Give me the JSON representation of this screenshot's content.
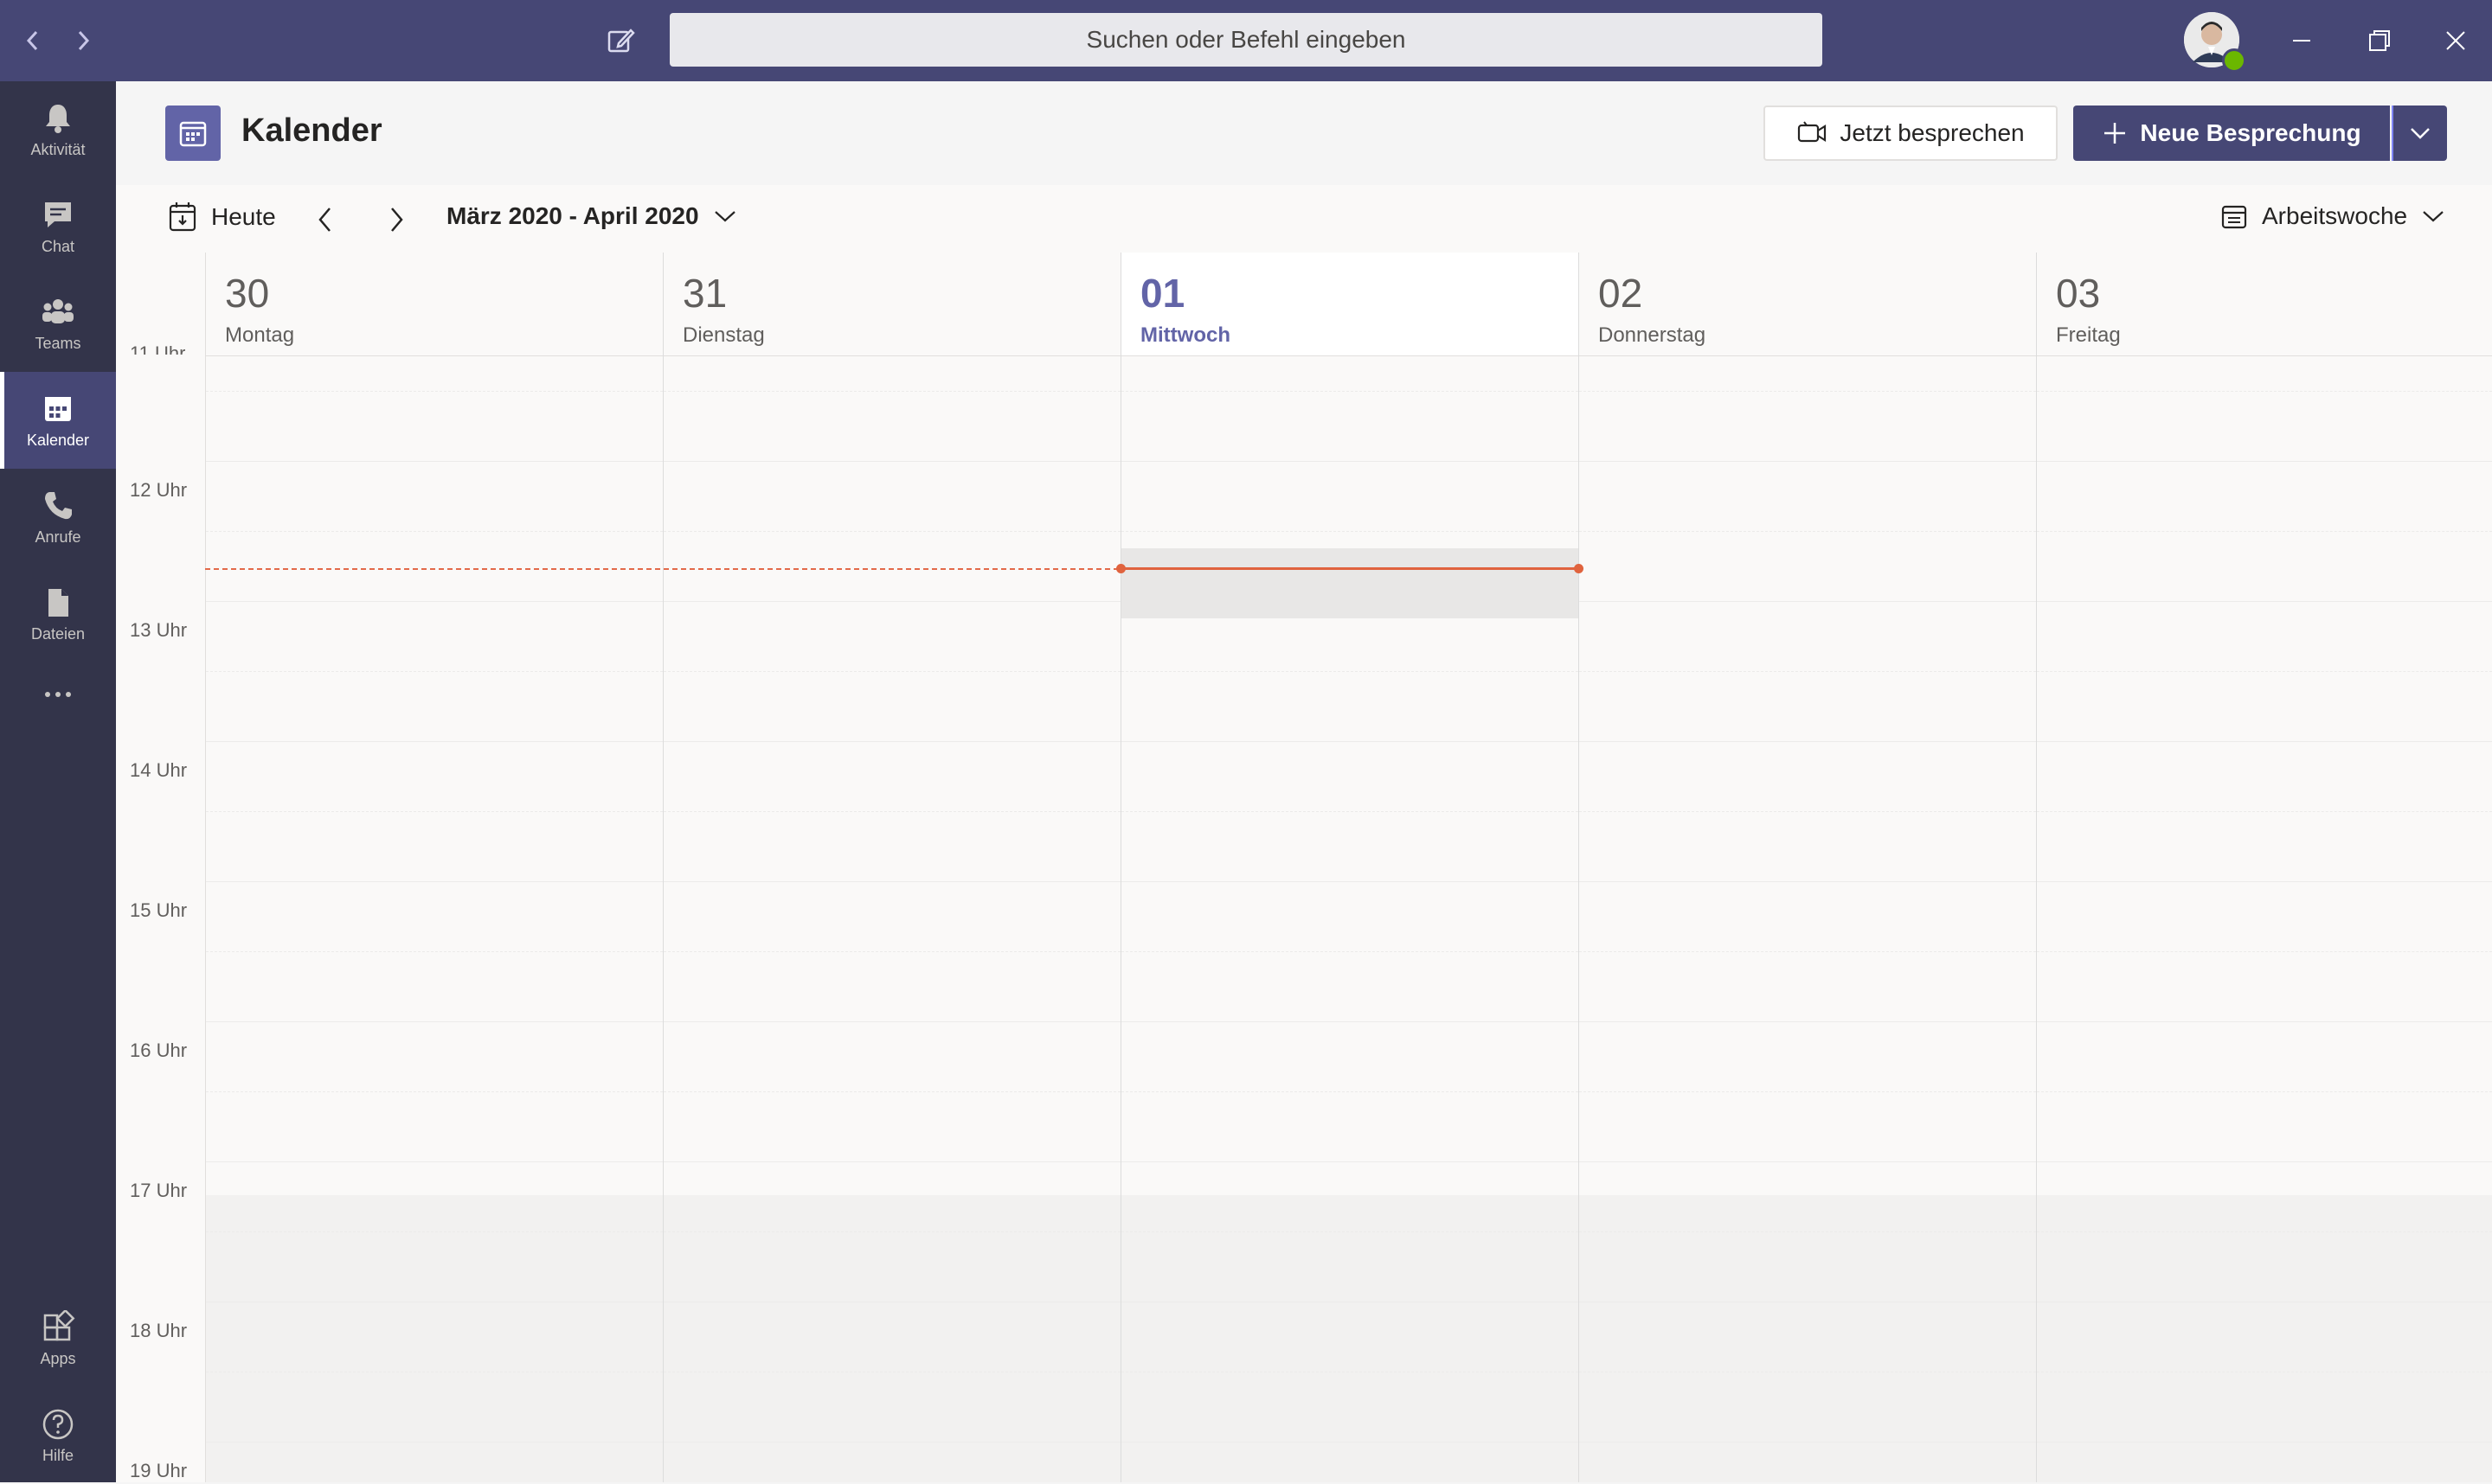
{
  "titlebar": {
    "search_placeholder": "Suchen oder Befehl eingeben",
    "accent": "#464775"
  },
  "rail": {
    "items": [
      {
        "label": "Aktivität",
        "icon": "bell-icon"
      },
      {
        "label": "Chat",
        "icon": "chat-icon"
      },
      {
        "label": "Teams",
        "icon": "teams-icon"
      },
      {
        "label": "Kalender",
        "icon": "calendar-icon",
        "active": true
      },
      {
        "label": "Anrufe",
        "icon": "phone-icon"
      },
      {
        "label": "Dateien",
        "icon": "file-icon"
      }
    ],
    "more_icon": "more-icon",
    "bottom": [
      {
        "label": "Apps",
        "icon": "apps-icon"
      },
      {
        "label": "Hilfe",
        "icon": "help-icon"
      }
    ]
  },
  "header": {
    "title": "Kalender",
    "meet_now": "Jetzt besprechen",
    "new_meeting": "Neue Besprechung"
  },
  "nav": {
    "today": "Heute",
    "range": "März 2020 - April 2020",
    "view": "Arbeitswoche"
  },
  "days": [
    {
      "num": "30",
      "name": "Montag"
    },
    {
      "num": "31",
      "name": "Dienstag"
    },
    {
      "num": "01",
      "name": "Mittwoch",
      "today": true
    },
    {
      "num": "02",
      "name": "Donnerstag"
    },
    {
      "num": "03",
      "name": "Freitag"
    }
  ],
  "hours": [
    "11 Uhr",
    "12 Uhr",
    "13 Uhr",
    "14 Uhr",
    "15 Uhr",
    "16 Uhr",
    "17 Uhr",
    "18 Uhr",
    "19 Uhr"
  ],
  "colors": {
    "brand": "#6264a7",
    "now_line": "#e0633e"
  }
}
